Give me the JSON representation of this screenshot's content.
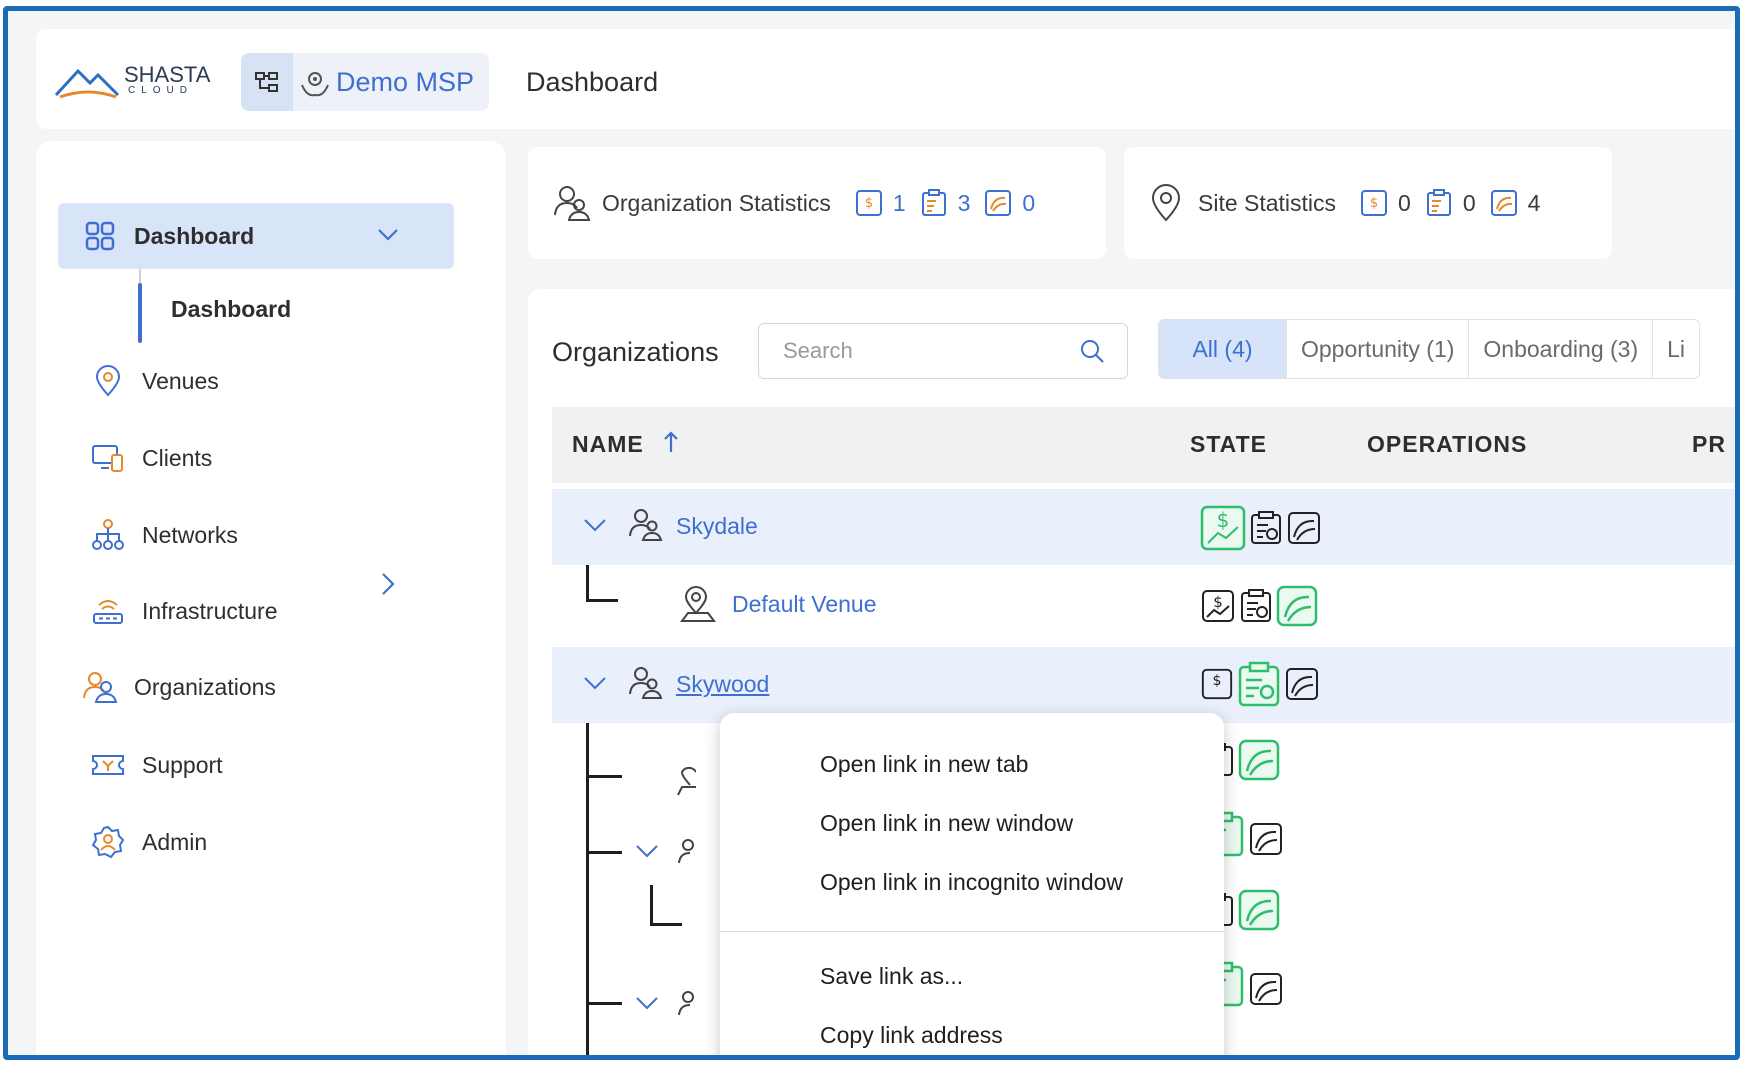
{
  "brand": {
    "name": "SHASTA",
    "sub": "CLOUD"
  },
  "msp": {
    "label": "Demo MSP"
  },
  "header": {
    "title": "Dashboard"
  },
  "sidebar": {
    "items": [
      {
        "label": "Dashboard",
        "icon": "grid-icon"
      },
      {
        "label": "Dashboard",
        "icon": ""
      },
      {
        "label": "Venues",
        "icon": "location-pin-icon"
      },
      {
        "label": "Clients",
        "icon": "devices-icon"
      },
      {
        "label": "Networks",
        "icon": "network-icon"
      },
      {
        "label": "Infrastructure",
        "icon": "access-point-icon"
      },
      {
        "label": "Organizations",
        "icon": "users-icon"
      },
      {
        "label": "Support",
        "icon": "support-icon"
      },
      {
        "label": "Admin",
        "icon": "admin-gear-icon"
      }
    ]
  },
  "org_stats": {
    "label": "Organization Statistics",
    "opportunity": "1",
    "onboarding": "3",
    "live": "0"
  },
  "site_stats": {
    "label": "Site Statistics",
    "opportunity": "0",
    "onboarding": "0",
    "live": "4"
  },
  "orgs": {
    "title": "Organizations",
    "search_placeholder": "Search",
    "tabs": [
      "All (4)",
      "Opportunity (1)",
      "Onboarding (3)",
      "Li"
    ],
    "columns": [
      "NAME",
      "STATE",
      "OPERATIONS",
      "PR"
    ],
    "rows": [
      {
        "name": "Skydale",
        "state_active": "opportunity"
      },
      {
        "name": "Default Venue",
        "state_active": "live"
      },
      {
        "name": "Skywood",
        "state_active": "onboarding"
      }
    ]
  },
  "context_menu": {
    "items": [
      "Open link in new tab",
      "Open link in new window",
      "Open link in incognito window",
      "Save link as...",
      "Copy link address"
    ]
  },
  "colors": {
    "accent": "#3f6fd1",
    "active_state": "#2ebd6b",
    "frame": "#1c6cb5"
  }
}
